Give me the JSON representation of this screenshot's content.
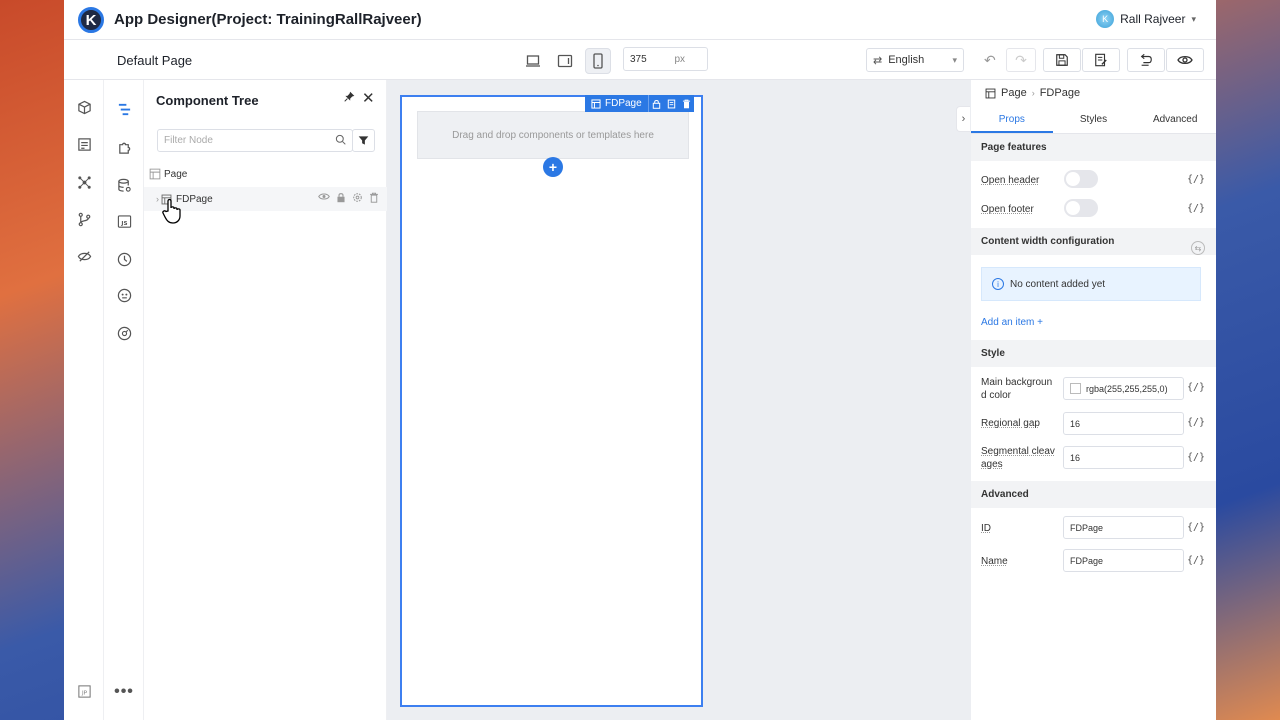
{
  "app": {
    "logo_letter": "K",
    "title": "App Designer(Project: TrainingRallRajveer)",
    "user_name": "Rall Rajveer",
    "user_initial": "K"
  },
  "toolbar": {
    "page_name": "Default Page",
    "width_value": "375",
    "width_unit": "px",
    "language": "English"
  },
  "tree": {
    "title": "Component Tree",
    "filter_placeholder": "Filter Node",
    "nodes": [
      {
        "label": "Page"
      },
      {
        "label": "FDPage"
      }
    ]
  },
  "canvas": {
    "badge_label": "FDPage",
    "drop_hint": "Drag and drop components or templates here",
    "add_symbol": "+"
  },
  "props": {
    "breadcrumb": [
      "Page",
      "FDPage"
    ],
    "tabs": [
      "Props",
      "Styles",
      "Advanced"
    ],
    "active_tab": "Props",
    "braces": "{/}",
    "page_features": {
      "header": "Page features",
      "open_header": "Open header",
      "open_footer": "Open footer"
    },
    "content_width": {
      "header": "Content width configuration",
      "empty": "No content added yet",
      "add_item": "Add an item +"
    },
    "style": {
      "header": "Style",
      "bg_label_1": "Main backgroun",
      "bg_label_2": "d color",
      "bg_value": "rgba(255,255,255,0)",
      "gap_label": "Regional gap",
      "gap_value": "16",
      "seg_label_1": "Segmental cleav",
      "seg_label_2": "ages",
      "seg_value": "16"
    },
    "advanced": {
      "header": "Advanced",
      "id_label": "ID",
      "id_value": "FDPage",
      "name_label": "Name",
      "name_value": "FDPage"
    }
  },
  "colors": {
    "accent": "#2b78e4",
    "canvas_bg": "#eceef2",
    "section_bg": "#f2f3f5"
  }
}
